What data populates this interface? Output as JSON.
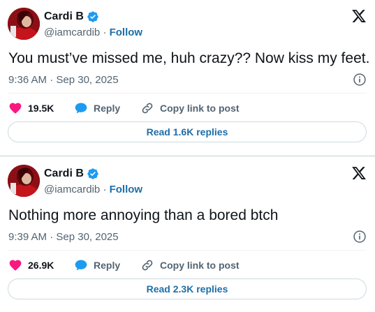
{
  "tweets": [
    {
      "author": {
        "name": "Cardi B",
        "handle": "@iamcardib",
        "follow_label": "Follow"
      },
      "text": "You must’ve missed me, huh crazy?? Now kiss my feet.",
      "timestamp": "9:36 AM · Sep 30, 2025",
      "likes": "19.5K",
      "reply_label": "Reply",
      "copy_link_label": "Copy link to post",
      "read_replies_label": "Read 1.6K replies"
    },
    {
      "author": {
        "name": "Cardi B",
        "handle": "@iamcardib",
        "follow_label": "Follow"
      },
      "text": "Nothing more annoying than a bored btch",
      "timestamp": "9:39 AM · Sep 30, 2025",
      "likes": "26.9K",
      "reply_label": "Reply",
      "copy_link_label": "Copy link to post",
      "read_replies_label": "Read 2.3K replies"
    }
  ],
  "icons": {
    "verified": "verified-badge-icon",
    "logo": "x-logo-icon",
    "info": "info-icon",
    "like": "heart-icon",
    "reply": "speech-bubble-icon",
    "copy_link": "link-icon"
  },
  "colors": {
    "verified": "#1d9bf0",
    "like": "#f91880",
    "reply": "#1d9bf0",
    "link_text": "#1d6ea8",
    "secondary_text": "#536471"
  }
}
